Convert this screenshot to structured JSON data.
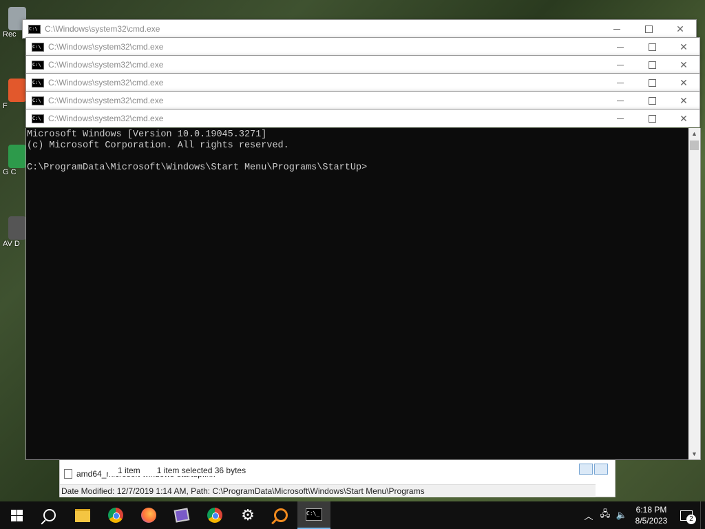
{
  "desktop": {
    "icons": [
      {
        "label": "Rec"
      },
      {
        "label": "F"
      },
      {
        "label": "G C"
      },
      {
        "label": "AV D"
      }
    ]
  },
  "explorer": {
    "file_name": "amd64_microsoft-windows-startup.lnk",
    "status_items": "1 item",
    "status_selected": "1 item selected  36 bytes",
    "footer": "Date Modified: 12/7/2019 1:14 AM, Path: C:\\ProgramData\\Microsoft\\Windows\\Start Menu\\Programs"
  },
  "windows": [
    {
      "title": "C:\\Windows\\system32\\cmd.exe"
    },
    {
      "title": "C:\\Windows\\system32\\cmd.exe"
    },
    {
      "title": "C:\\Windows\\system32\\cmd.exe"
    },
    {
      "title": "C:\\Windows\\system32\\cmd.exe"
    },
    {
      "title": "C:\\Windows\\system32\\cmd.exe"
    },
    {
      "title": "C:\\Windows\\system32\\cmd.exe"
    }
  ],
  "console": {
    "line1": "Microsoft Windows [Version 10.0.19045.3271]",
    "line2": "(c) Microsoft Corporation. All rights reserved.",
    "line3": "",
    "line4": "C:\\ProgramData\\Microsoft\\Windows\\Start Menu\\Programs\\StartUp>"
  },
  "taskbar": {
    "icons": [
      "windows-start-icon",
      "search-icon",
      "file-explorer-icon",
      "chrome-icon",
      "firefox-icon",
      "video-editor-icon",
      "chrome-icon",
      "settings-gear-icon",
      "search-tool-icon",
      "cmd-icon"
    ],
    "time": "6:18 PM",
    "date": "8/5/2023",
    "notification_count": "2"
  },
  "colors": {
    "console_bg": "#0c0c0c",
    "console_fg": "#cccccc",
    "taskbar_bg": "#101010"
  }
}
